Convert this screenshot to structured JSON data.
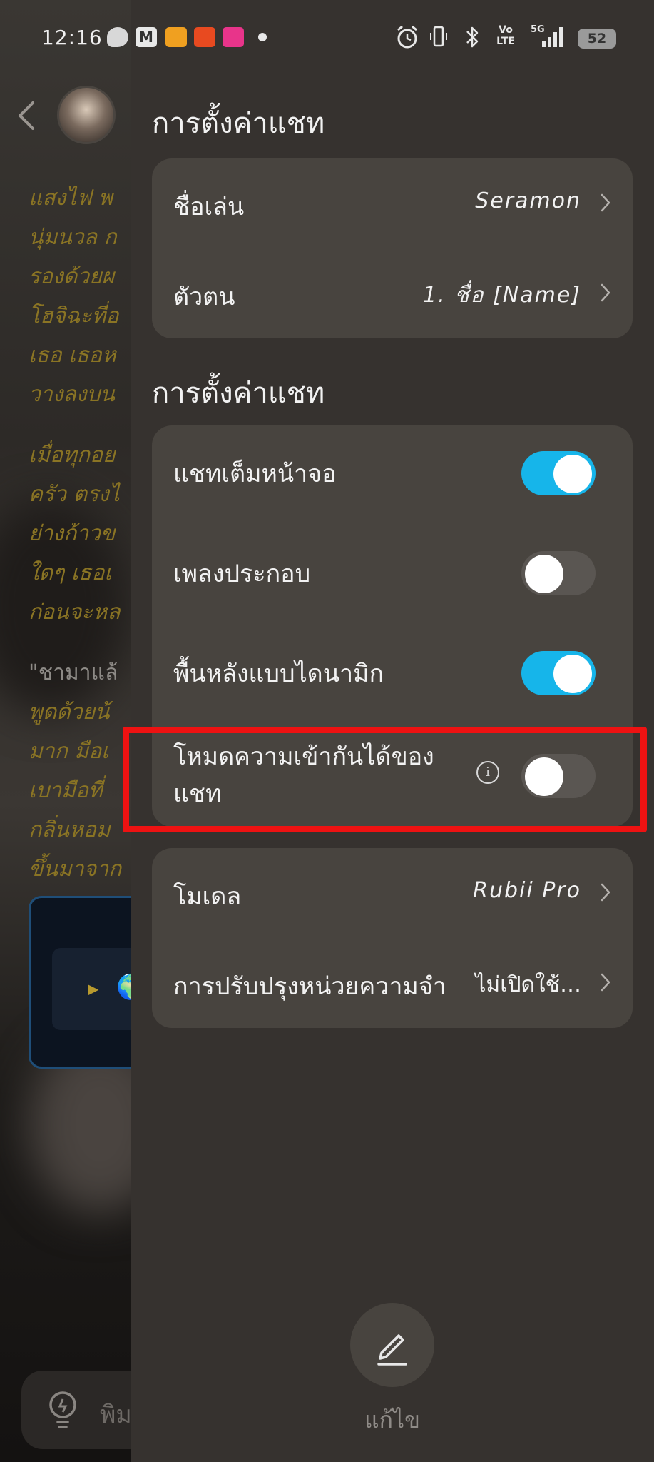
{
  "status_bar": {
    "time": "12:16",
    "battery": "52",
    "network": "5G",
    "volte": "Vo LTE"
  },
  "chat_background": {
    "story_lines_1": [
      "แสงไฟ พ",
      "นุ่มนวล ก",
      "รองด้วยผ",
      "โฮจิฉะที่อ",
      "เธอ เธอห",
      "วางลงบน"
    ],
    "story_lines_2": [
      "เมื่อทุกอย",
      "ครัว ตรงไ",
      "ย่างก้าวข",
      "ใดๆ เธอเ",
      "ก่อนจะหล"
    ],
    "quote_first": "\"ชามาแล้",
    "story_lines_3": [
      "พูดด้วยน้",
      "มาก มือเ",
      "เบามือที่",
      "กลิ่นหอม",
      "ขึ้นมาจาก"
    ],
    "input_placeholder": "พิม"
  },
  "panel": {
    "section1_title": "การตั้งค่าแชท",
    "nickname_label": "ชื่อเล่น",
    "nickname_value": "Seramon",
    "persona_label": "ตัวตน",
    "persona_value": "1. ชื่อ [Name]",
    "section2_title": "การตั้งค่าแชท",
    "fullscreen_label": "แชทเต็มหน้าจอ",
    "fullscreen_on": true,
    "music_label": "เพลงประกอบ",
    "music_on": false,
    "dynamic_bg_label": "พื้นหลังแบบไดนามิก",
    "dynamic_bg_on": true,
    "compat_label_line1": "โหมดความเข้ากันได้ของ",
    "compat_label_line2": "แชท",
    "compat_on": false,
    "model_label": "โมเดล",
    "model_value": "Rubii Pro",
    "memory_label": "การปรับปรุงหน่วยความจำ",
    "memory_value": "ไม่เปิดใช้…",
    "edit_label": "แก้ไข"
  },
  "colors": {
    "toggle_on": "#16b5ea",
    "highlight": "#ee1212",
    "panel_bg": "#36322f",
    "card_bg": "#48443f"
  },
  "icons": [
    "back-chevron-icon",
    "bulb-icon",
    "chevron-right-icon",
    "info-icon",
    "pencil-icon",
    "alarm-icon",
    "bluetooth-icon",
    "signal-icon",
    "battery-icon"
  ]
}
